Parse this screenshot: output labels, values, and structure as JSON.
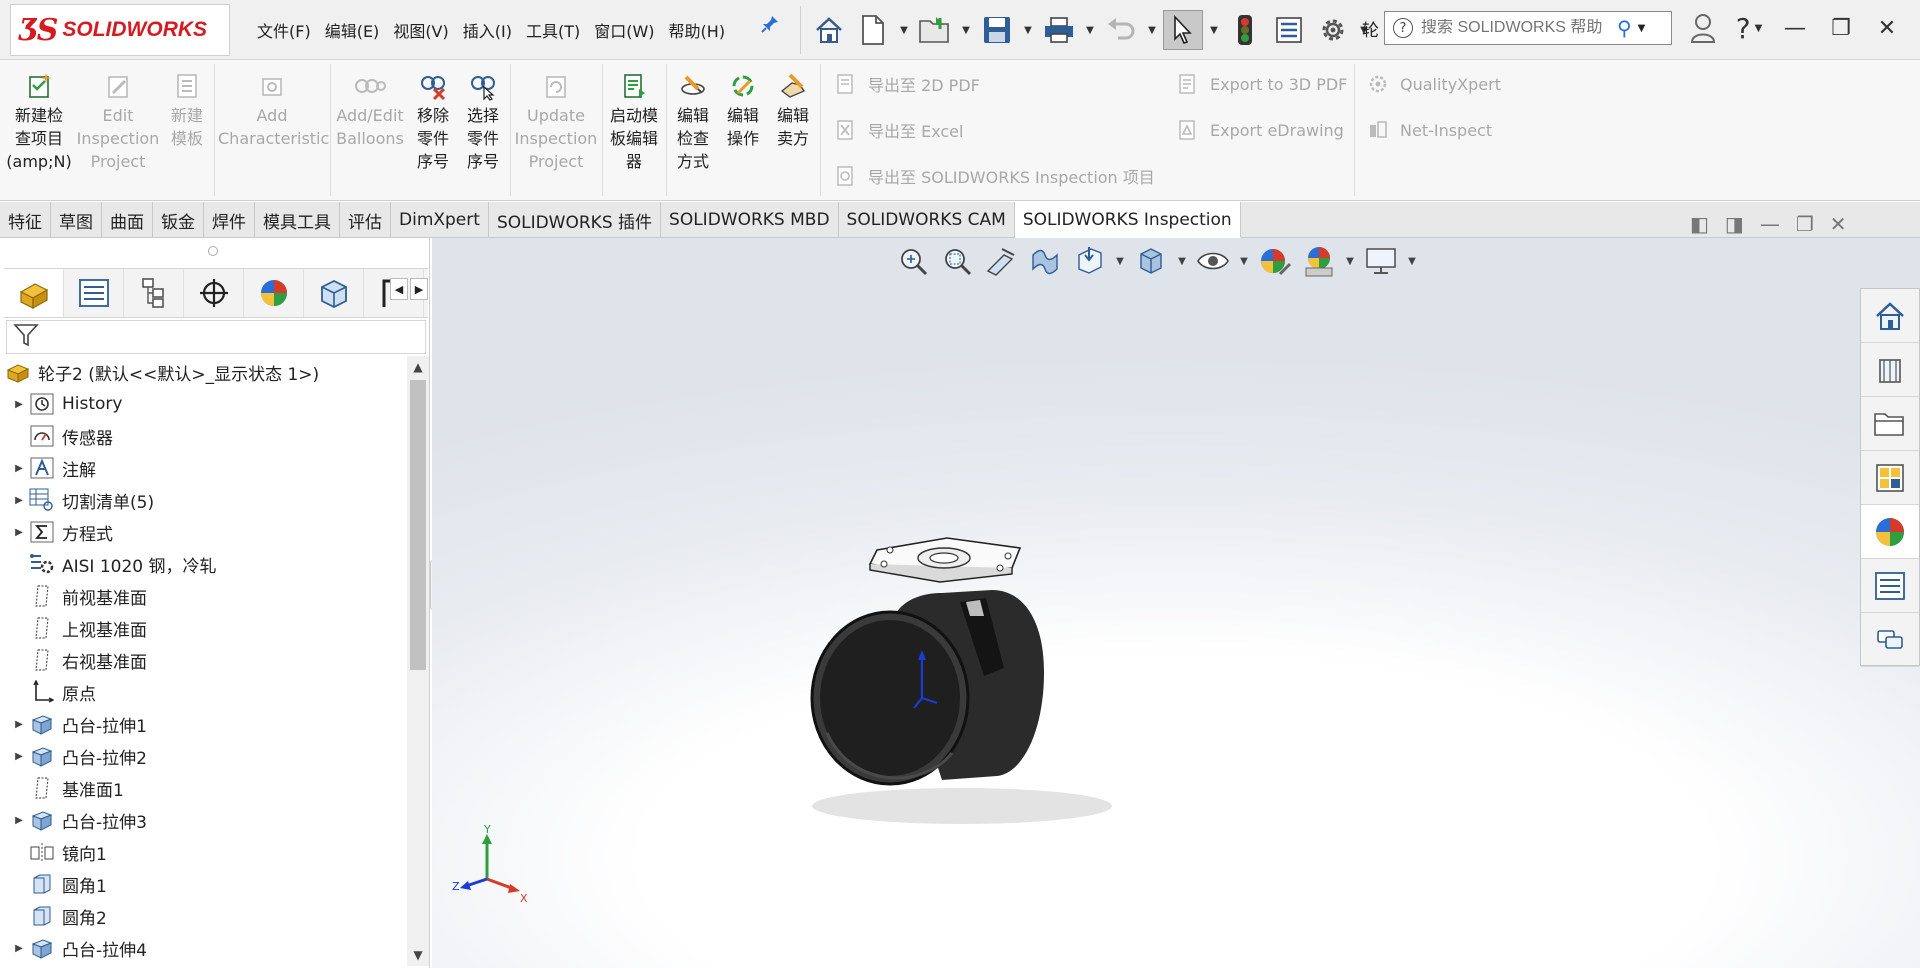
{
  "app": {
    "logo_brand": "SOLIDWORKS",
    "menus": [
      "文件(F)",
      "编辑(E)",
      "视图(V)",
      "插入(I)",
      "工具(T)",
      "窗口(W)",
      "帮助(H)"
    ],
    "truncated_label": "轮",
    "search_placeholder": "搜索 SOLIDWORKS 帮助",
    "colors": {
      "brand_red": "#d71920",
      "accent_blue": "#2a6fd6"
    }
  },
  "ribbon": {
    "buttons": [
      {
        "label": "新建检\n查项目\n(amp;N)",
        "enabled": true
      },
      {
        "label": "Edit\nInspection\nProject",
        "enabled": false
      },
      {
        "label": "新建\n模板",
        "enabled": false
      },
      {
        "label": "Add\nCharacteristic",
        "enabled": false
      },
      {
        "label": "Add/Edit\nBalloons",
        "enabled": false
      },
      {
        "label": "移除\n零件\n序号",
        "enabled": true
      },
      {
        "label": "选择\n零件\n序号",
        "enabled": true
      },
      {
        "label": "Update\nInspection\nProject",
        "enabled": false
      },
      {
        "label": "启动模\n板编辑\n器",
        "enabled": true
      },
      {
        "label": "编辑\n检查\n方式",
        "enabled": true
      },
      {
        "label": "编辑\n操作",
        "enabled": true
      },
      {
        "label": "编辑\n卖方",
        "enabled": true
      }
    ],
    "export_items": {
      "pdf2d": "导出至 2D PDF",
      "excel": "导出至 Excel",
      "inspection_project": "导出至 SOLIDWORKS Inspection 项目",
      "pdf3d": "Export to 3D PDF",
      "edrawing": "Export eDrawing",
      "qualityxpert": "QualityXpert",
      "netinspect": "Net-Inspect"
    }
  },
  "tabs": {
    "items": [
      "特征",
      "草图",
      "曲面",
      "钣金",
      "焊件",
      "模具工具",
      "评估",
      "DimXpert",
      "SOLIDWORKS 插件",
      "SOLIDWORKS MBD",
      "SOLIDWORKS CAM",
      "SOLIDWORKS Inspection"
    ],
    "active": "SOLIDWORKS Inspection"
  },
  "tree": {
    "root": "轮子2  (默认<<默认>_显示状态 1>)",
    "items": [
      {
        "label": "History",
        "expandable": true,
        "icon": "history-icon"
      },
      {
        "label": "传感器",
        "expandable": false,
        "icon": "sensor-icon"
      },
      {
        "label": "注解",
        "expandable": true,
        "icon": "annotation-icon"
      },
      {
        "label": "切割清单(5)",
        "expandable": true,
        "icon": "cut-list-icon"
      },
      {
        "label": "方程式",
        "expandable": true,
        "icon": "equation-icon"
      },
      {
        "label": "AISI 1020 钢，冷轧",
        "expandable": false,
        "icon": "material-icon"
      },
      {
        "label": "前视基准面",
        "expandable": false,
        "icon": "plane-icon"
      },
      {
        "label": "上视基准面",
        "expandable": false,
        "icon": "plane-icon"
      },
      {
        "label": "右视基准面",
        "expandable": false,
        "icon": "plane-icon"
      },
      {
        "label": "原点",
        "expandable": false,
        "icon": "origin-icon"
      },
      {
        "label": "凸台-拉伸1",
        "expandable": true,
        "icon": "boss-extrude-icon"
      },
      {
        "label": "凸台-拉伸2",
        "expandable": true,
        "icon": "boss-extrude-icon"
      },
      {
        "label": "基准面1",
        "expandable": false,
        "icon": "plane-icon"
      },
      {
        "label": "凸台-拉伸3",
        "expandable": true,
        "icon": "boss-extrude-icon"
      },
      {
        "label": "镜向1",
        "expandable": false,
        "icon": "mirror-icon"
      },
      {
        "label": "圆角1",
        "expandable": false,
        "icon": "fillet-icon"
      },
      {
        "label": "圆角2",
        "expandable": false,
        "icon": "fillet-icon"
      },
      {
        "label": "凸台-拉伸4",
        "expandable": true,
        "icon": "boss-extrude-icon"
      }
    ]
  },
  "viewport": {
    "triad": {
      "x": "X",
      "y": "Y",
      "z": "Z"
    }
  }
}
